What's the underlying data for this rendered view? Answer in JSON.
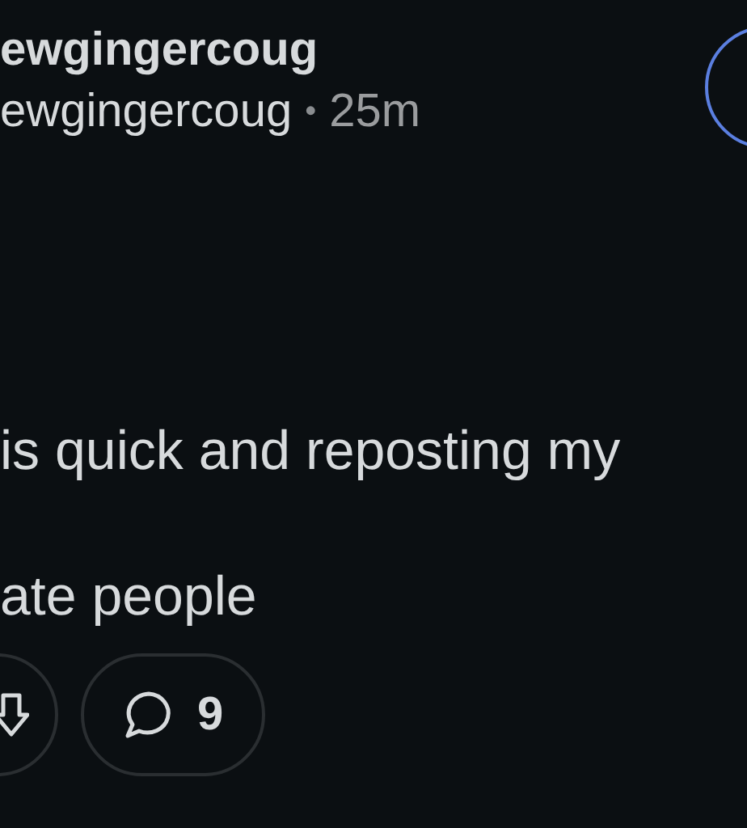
{
  "post": {
    "author": "ewgingercoug",
    "handle": "ewgingercoug",
    "separator": "•",
    "time": "25m",
    "body_lines": [
      "is quick and reposting my",
      "ate people"
    ],
    "comment_count": "9"
  }
}
